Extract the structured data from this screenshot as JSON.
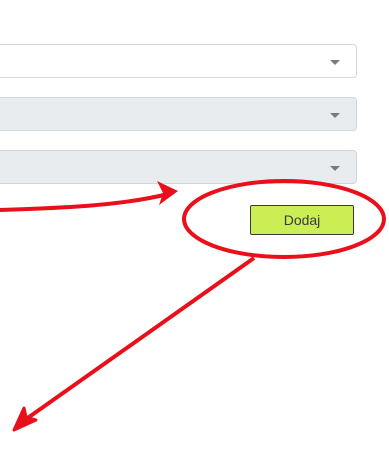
{
  "form": {
    "select_1": {
      "value": ""
    },
    "select_2": {
      "value": ""
    },
    "select_3": {
      "value": ""
    },
    "add_button_label": "Dodaj"
  },
  "icons": {
    "dropdown": "caret-down-icon"
  },
  "colors": {
    "button_background": "#ccee55",
    "button_border": "#3a3a3a",
    "annotation": "#e8101a",
    "disabled_select": "#e9ecef"
  }
}
